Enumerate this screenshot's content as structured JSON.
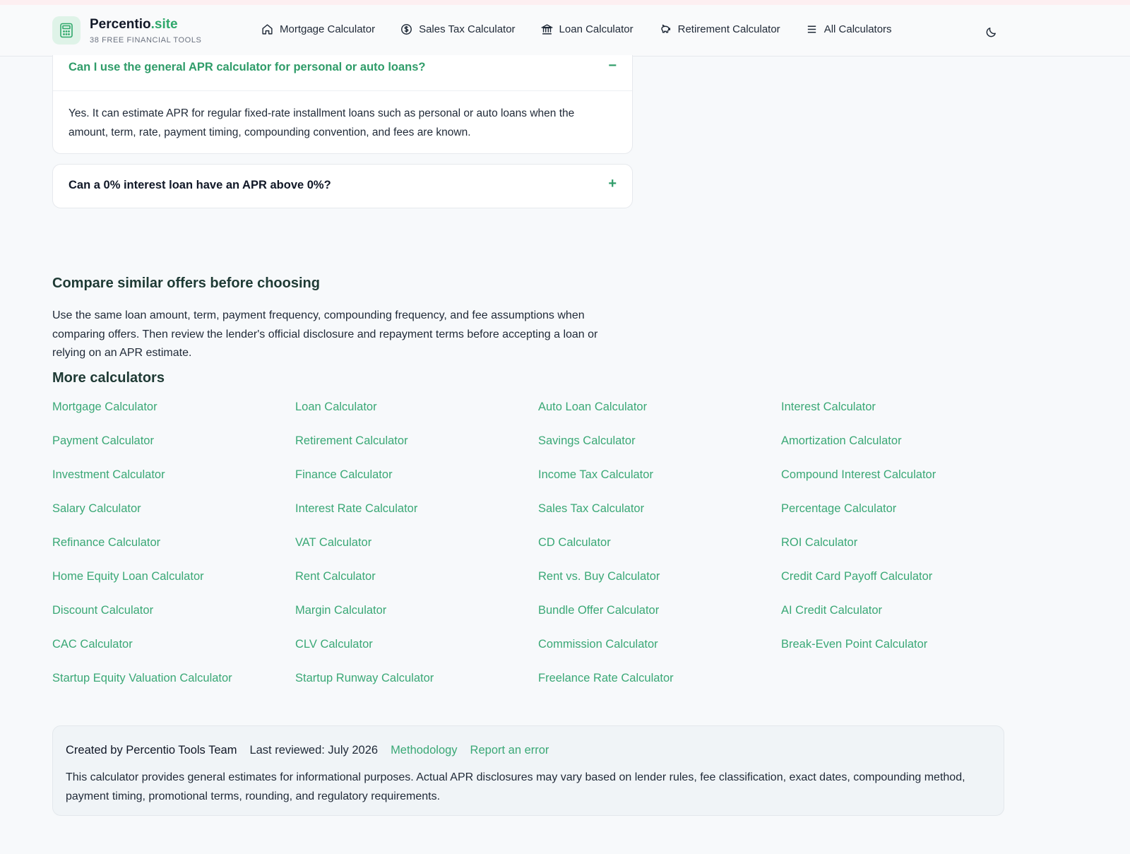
{
  "header": {
    "brand_name": "Percentio",
    "brand_tld": ".site",
    "brand_sub": "38 FREE FINANCIAL TOOLS",
    "logo_icon": "calculator-icon",
    "nav": [
      {
        "label": "Mortgage Calculator",
        "icon": "home-icon"
      },
      {
        "label": "Sales Tax Calculator",
        "icon": "dollar-circle-icon"
      },
      {
        "label": "Loan Calculator",
        "icon": "bank-icon"
      },
      {
        "label": "Retirement Calculator",
        "icon": "piggy-bank-icon"
      },
      {
        "label": "All Calculators",
        "icon": "menu-icon"
      }
    ],
    "theme_icon": "moon-icon"
  },
  "faq": {
    "open": {
      "question": "Can I use the general APR calculator for personal or auto loans?",
      "toggle": "−",
      "answer": "Yes. It can estimate APR for regular fixed-rate installment loans such as personal or auto loans when the amount, term, rate, payment timing, compounding convention, and fees are known."
    },
    "closed": {
      "question": "Can a 0% interest loan have an APR above 0%?",
      "toggle": "+"
    }
  },
  "compare": {
    "title": "Compare similar offers before choosing",
    "text": "Use the same loan amount, term, payment frequency, compounding frequency, and fee assumptions when comparing offers. Then review the lender's official disclosure and repayment terms before accepting a loan or relying on an APR estimate."
  },
  "more": {
    "title": "More calculators",
    "links": [
      "Mortgage Calculator",
      "Loan Calculator",
      "Auto Loan Calculator",
      "Interest Calculator",
      "Payment Calculator",
      "Retirement Calculator",
      "Savings Calculator",
      "Amortization Calculator",
      "Investment Calculator",
      "Finance Calculator",
      "Income Tax Calculator",
      "Compound Interest Calculator",
      "Salary Calculator",
      "Interest Rate Calculator",
      "Sales Tax Calculator",
      "Percentage Calculator",
      "Refinance Calculator",
      "VAT Calculator",
      "CD Calculator",
      "ROI Calculator",
      "Home Equity Loan Calculator",
      "Rent Calculator",
      "Rent vs. Buy Calculator",
      "Credit Card Payoff Calculator",
      "Discount Calculator",
      "Margin Calculator",
      "Bundle Offer Calculator",
      "AI Credit Calculator",
      "CAC Calculator",
      "CLV Calculator",
      "Commission Calculator",
      "Break-Even Point Calculator",
      "Startup Equity Valuation Calculator",
      "Startup Runway Calculator",
      "Freelance Rate Calculator"
    ]
  },
  "footer": {
    "created": "Created by Percentio Tools Team",
    "reviewed": "Last reviewed: July 2026",
    "methodology": "Methodology",
    "report": "Report an error",
    "disclaimer": "This calculator provides general estimates for informational purposes. Actual APR disclosures may vary based on lender rules, fee classification, exact dates, compounding method, payment timing, promotional terms, rounding, and regulatory requirements."
  },
  "colors": {
    "accent": "#3aa876",
    "accent_dark": "#2f9c69",
    "heading": "#1e3a34"
  }
}
